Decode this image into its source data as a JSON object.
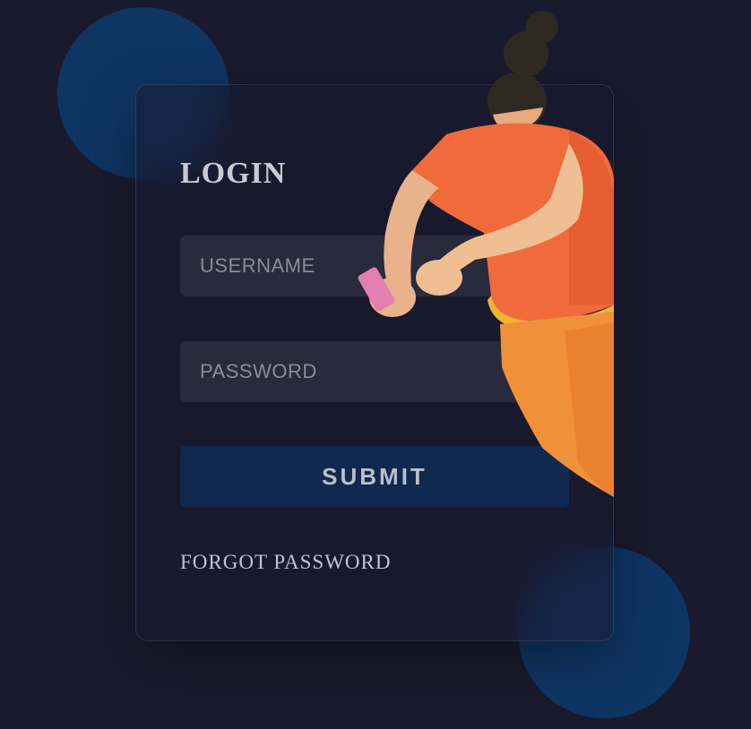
{
  "login": {
    "title": "LOGIN",
    "username_placeholder": "USERNAME",
    "password_placeholder": "PASSWORD",
    "submit_label": "SUBMIT",
    "forgot_label": "FORGOT PASSWORD"
  },
  "theme": {
    "background": "#1a1a2e",
    "accent_blob": "#0f3563",
    "input_bg": "#292a3c",
    "button_bg": "#11284f",
    "figure_shirt": "#f06a3c",
    "figure_pants": "#f0913a",
    "figure_hair": "#2e2a22"
  },
  "icons": {
    "illustration": "woman-with-phone-illustration"
  }
}
